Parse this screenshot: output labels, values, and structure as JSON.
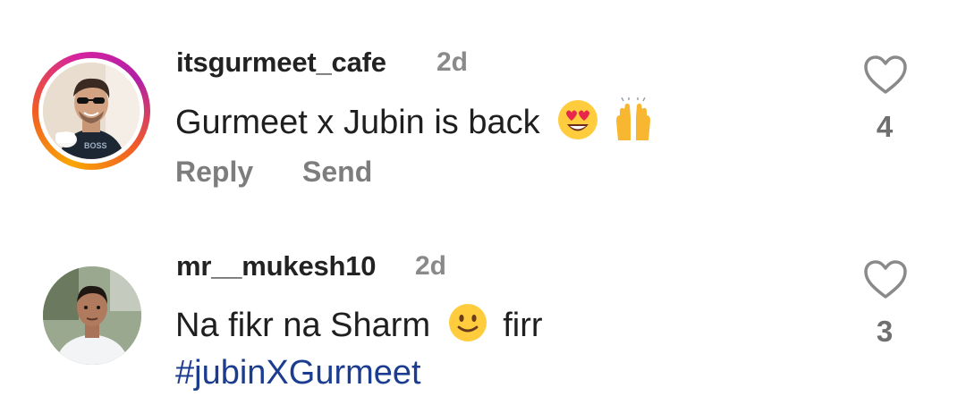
{
  "comments": [
    {
      "username": "itsgurmeet_cafe",
      "time": "2d",
      "text": "Gurmeet x Jubin is back",
      "emojis": [
        "heart-eyes-emoji",
        "raising-hands-emoji"
      ],
      "actions": {
        "reply": "Reply",
        "send": "Send"
      },
      "likes": "4",
      "has_story_ring": true
    },
    {
      "username": "mr__mukesh10",
      "time": "2d",
      "text_before": "Na fikr na Sharm",
      "text_after": "firr",
      "emoji": "slightly-smiling-emoji",
      "hashtag": "#jubinXGurmeet",
      "likes": "3",
      "has_story_ring": false
    }
  ],
  "colors": {
    "hashtag": "#1c3d8f",
    "muted": "#7d7d7d",
    "heart_outline": "#8a8a8a"
  }
}
